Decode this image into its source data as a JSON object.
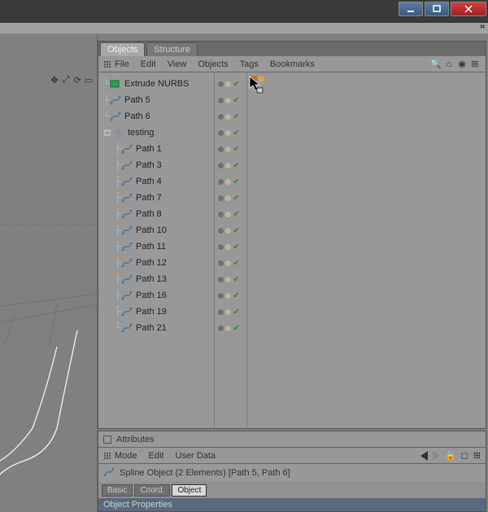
{
  "tabs": {
    "objects": "Objects",
    "structure": "Structure"
  },
  "menu": {
    "file": "File",
    "edit": "Edit",
    "view": "View",
    "objects": "Objects",
    "tags": "Tags",
    "bookmarks": "Bookmarks"
  },
  "tree": {
    "r0": "Extrude NURBS",
    "r1": "Path 5",
    "r2": "Path 6",
    "group": "testing",
    "children": [
      "Path 1",
      "Path 3",
      "Path 4",
      "Path 7",
      "Path 8",
      "Path 10",
      "Path 11",
      "Path 12",
      "Path 13",
      "Path 16",
      "Path 19",
      "Path 21"
    ]
  },
  "attributes": {
    "title": "Attributes",
    "menu": {
      "mode": "Mode",
      "edit": "Edit",
      "userdata": "User Data"
    },
    "objline": "Spline Object (2 Elements) [Path 5, Path 6]",
    "tabs": {
      "basic": "Basic",
      "coord": "Coord.",
      "object": "Object"
    },
    "section": "Object Properties"
  }
}
